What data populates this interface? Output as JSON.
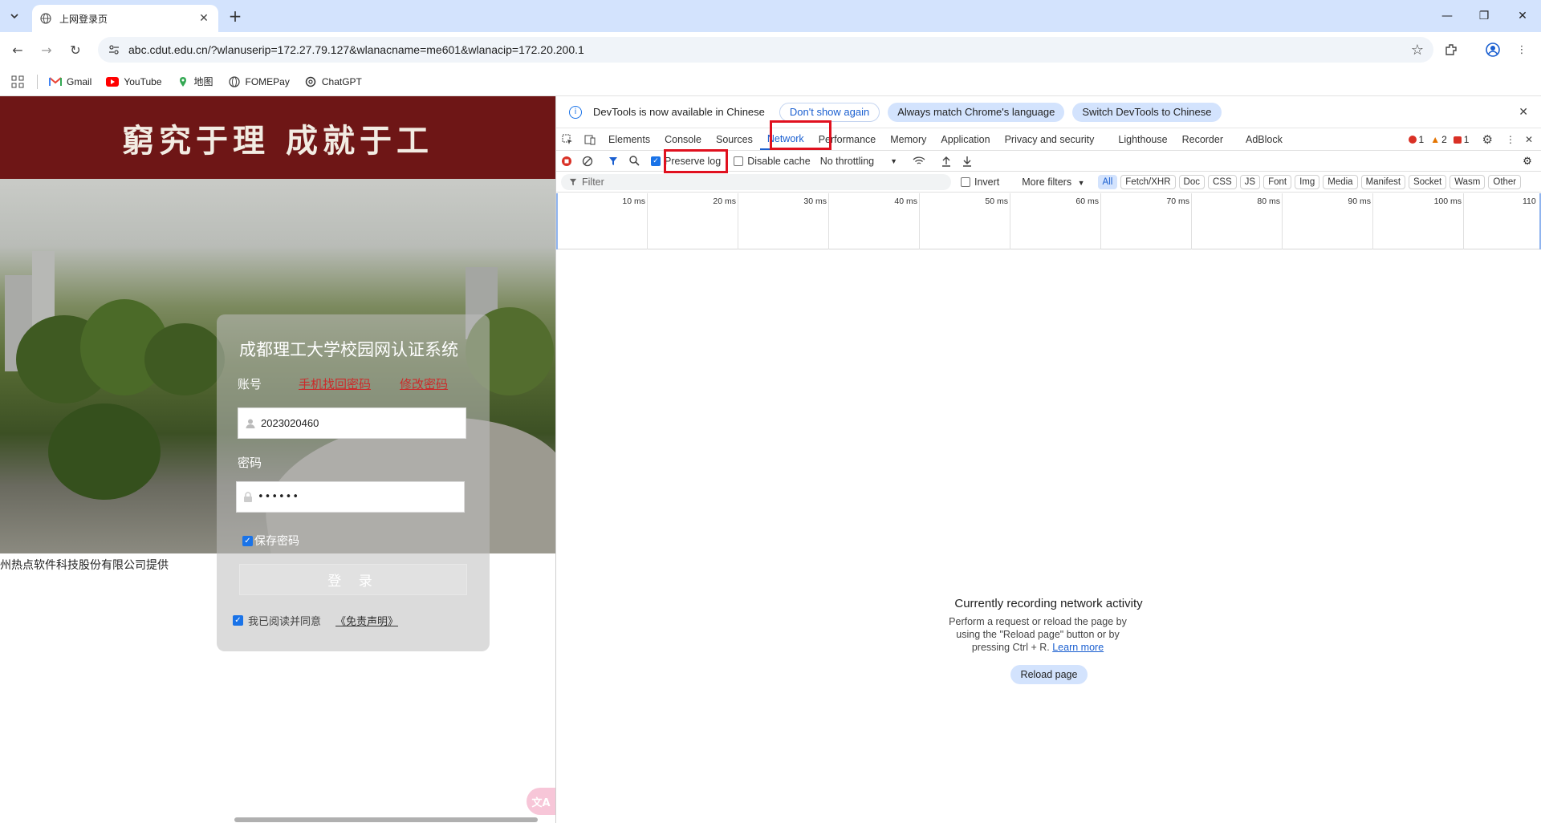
{
  "browser": {
    "tab_title": "上网登录页",
    "url": "abc.cdut.edu.cn/?wlanuserip=172.27.79.127&wlanacname=me601&wlanacip=172.20.200.1"
  },
  "bookmarks": [
    {
      "label": "Gmail",
      "icon": "gmail-icon"
    },
    {
      "label": "YouTube",
      "icon": "youtube-icon"
    },
    {
      "label": "地图",
      "icon": "maps-icon"
    },
    {
      "label": "FOMEPay",
      "icon": "globe-icon"
    },
    {
      "label": "ChatGPT",
      "icon": "chatgpt-icon"
    }
  ],
  "page": {
    "banner": "窮究于理 成就于工",
    "login_title": "成都理工大学校园网认证系统",
    "account_label": "账号",
    "phone_recover_link": "手机找回密码",
    "change_pwd_link": "修改密码",
    "username_value": "2023020460",
    "password_label": "密码",
    "password_value": "••••••",
    "save_password": "保存密码",
    "login_button": "登 录",
    "agree_text": "我已阅读并同意",
    "disclaimer": "《免责声明》",
    "footer": "州热点软件科技股份有限公司提供",
    "translate_icon": "translate-icon"
  },
  "devtools": {
    "info_message": "DevTools is now available in Chinese",
    "dont_show_again": "Don't show again",
    "always_match": "Always match Chrome's language",
    "switch_chinese": "Switch DevTools to Chinese",
    "tabs": [
      "Elements",
      "Console",
      "Sources",
      "Network",
      "Performance",
      "Memory",
      "Application",
      "Privacy and security",
      "Lighthouse",
      "Recorder",
      "AdBlock"
    ],
    "active_tab": "Network",
    "errors": "1",
    "warnings": "2",
    "issues": "1",
    "preserve_log": "Preserve log",
    "disable_cache": "Disable cache",
    "throttling": "No throttling",
    "filter_placeholder": "Filter",
    "invert": "Invert",
    "more_filters": "More filters",
    "filter_types": [
      "All",
      "Fetch/XHR",
      "Doc",
      "CSS",
      "JS",
      "Font",
      "Img",
      "Media",
      "Manifest",
      "Socket",
      "Wasm",
      "Other"
    ],
    "timeline_ticks": [
      "10 ms",
      "20 ms",
      "30 ms",
      "40 ms",
      "50 ms",
      "60 ms",
      "70 ms",
      "80 ms",
      "90 ms",
      "100 ms",
      "110"
    ],
    "empty_title": "Currently recording network activity",
    "empty_desc": "Perform a request or reload the page by using the \"Reload page\" button or by pressing Ctrl + R.",
    "learn_more": "Learn more",
    "reload_button": "Reload page"
  },
  "colors": {
    "banner": "#6e1616",
    "highlight_red": "#e0101e",
    "devtools_accent": "#1a5fd0"
  }
}
